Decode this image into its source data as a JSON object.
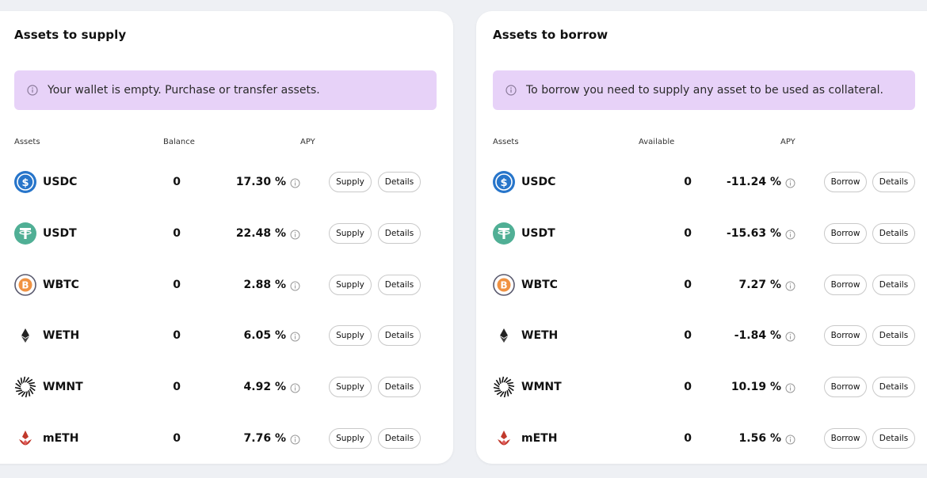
{
  "supply": {
    "title": "Assets to supply",
    "banner_text": "Your wallet is empty. Purchase or transfer assets.",
    "headers": {
      "assets": "Assets",
      "balance": "Balance",
      "apy": "APY"
    },
    "action_label": "Supply",
    "details_label": "Details",
    "rows": [
      {
        "icon": "usdc-icon",
        "name": "USDC",
        "balance": "0",
        "apy": "17.30 %"
      },
      {
        "icon": "usdt-icon",
        "name": "USDT",
        "balance": "0",
        "apy": "22.48 %"
      },
      {
        "icon": "wbtc-icon",
        "name": "WBTC",
        "balance": "0",
        "apy": "2.88 %"
      },
      {
        "icon": "weth-icon",
        "name": "WETH",
        "balance": "0",
        "apy": "6.05 %"
      },
      {
        "icon": "wmnt-icon",
        "name": "WMNT",
        "balance": "0",
        "apy": "4.92 %"
      },
      {
        "icon": "meth-icon",
        "name": "mETH",
        "balance": "0",
        "apy": "7.76 %"
      }
    ]
  },
  "borrow": {
    "title": "Assets to borrow",
    "banner_text": "To borrow you need to supply any asset to be used as collateral.",
    "headers": {
      "assets": "Assets",
      "available": "Available",
      "apy": "APY"
    },
    "action_label": "Borrow",
    "details_label": "Details",
    "rows": [
      {
        "icon": "usdc-icon",
        "name": "USDC",
        "available": "0",
        "apy": "-11.24 %"
      },
      {
        "icon": "usdt-icon",
        "name": "USDT",
        "available": "0",
        "apy": "-15.63 %"
      },
      {
        "icon": "wbtc-icon",
        "name": "WBTC",
        "available": "0",
        "apy": "7.27 %"
      },
      {
        "icon": "weth-icon",
        "name": "WETH",
        "available": "0",
        "apy": "-1.84 %"
      },
      {
        "icon": "wmnt-icon",
        "name": "WMNT",
        "available": "0",
        "apy": "10.19 %"
      },
      {
        "icon": "meth-icon",
        "name": "mETH",
        "available": "0",
        "apy": "1.56 %"
      }
    ]
  },
  "colors": {
    "banner_bg": "#e7d2f8",
    "page_bg": "#eef0f4",
    "usdc": "#2775ca",
    "usdt": "#50af95",
    "wbtc": "#f09242",
    "meth": "#c0392b"
  }
}
